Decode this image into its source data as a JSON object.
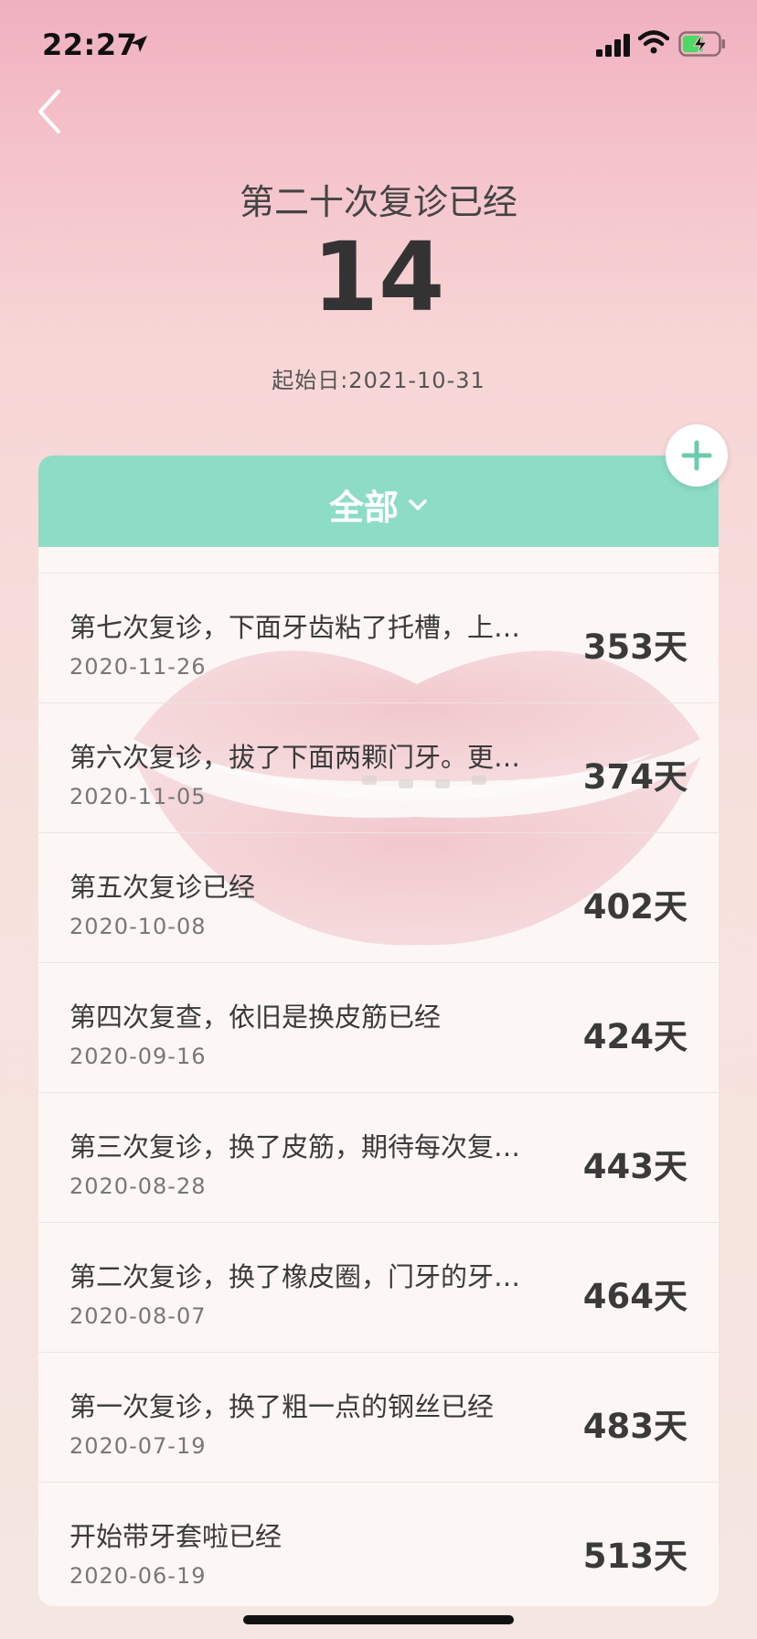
{
  "status_bar": {
    "time": "22:27"
  },
  "header": {
    "title": "第二十次复诊已经",
    "count": "14",
    "start_date": "起始日:2021-10-31"
  },
  "filter": {
    "label": "全部"
  },
  "colors": {
    "accent": "#8ddcc6",
    "add_icon": "#6ccba8"
  },
  "list": [
    {
      "title": "第七次复诊，下面牙齿粘了托槽，上…",
      "date": "2020-11-26",
      "days": "353天"
    },
    {
      "title": "第六次复诊，拔了下面两颗门牙。更…",
      "date": "2020-11-05",
      "days": "374天"
    },
    {
      "title": "第五次复诊已经",
      "date": "2020-10-08",
      "days": "402天"
    },
    {
      "title": "第四次复查，依旧是换皮筋已经",
      "date": "2020-09-16",
      "days": "424天"
    },
    {
      "title": "第三次复诊，换了皮筋，期待每次复…",
      "date": "2020-08-28",
      "days": "443天"
    },
    {
      "title": "第二次复诊，换了橡皮圈，门牙的牙…",
      "date": "2020-08-07",
      "days": "464天"
    },
    {
      "title": "第一次复诊，换了粗一点的钢丝已经",
      "date": "2020-07-19",
      "days": "483天"
    },
    {
      "title": "开始带牙套啦已经",
      "date": "2020-06-19",
      "days": "513天"
    }
  ]
}
